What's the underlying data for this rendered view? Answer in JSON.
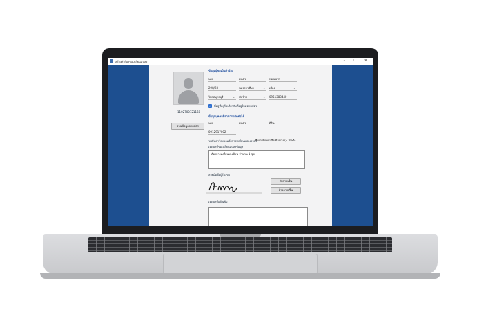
{
  "window": {
    "title": "สร้างคำร้องขอเปลี่ยนแปลง",
    "controls": "– ☐ ✕"
  },
  "photo": {
    "id_number": "1102700721168",
    "scan_button": "อ่านข้อมูลจากบัตร"
  },
  "applicant": {
    "section_title": "ข้อมูลผู้ขอเป็นคำร้อง",
    "title": "นาย",
    "first_name": "มนตร",
    "last_name": "ทองเพชร",
    "house_no": "298/23",
    "district": "นครราชสีมา",
    "subdistrict": "เมือง",
    "province": "ไทรสมุทรบุรี",
    "zone": "ทับข้าง",
    "phone": "0951383440",
    "same_address_label": "ที่อยู่ที่อยู่ร้อเดียวกับที่อยู่ใหม่ตามบัตร"
  },
  "contact": {
    "section_title": "ข้อมูลบุคคลที่สามารถติดต่อได้",
    "title": "นาย",
    "first_name": "มนตร",
    "last_name": "ศิริน",
    "phone": "0912917002"
  },
  "request": {
    "type_label": "ขอยื่นคำร้องขอแจ้งการเปลี่ยนแปลงรายนี้",
    "type_value": "ยืนยันชื่อหนังสือเดินทาง (E VISA)",
    "details_label": "เหตุผลที่ขอเปลี่ยนแปลงข้อมูล",
    "details_value": "ต้องการเปลี่ยนทะเบียน จำนวน 1 ชุด"
  },
  "signature": {
    "label": "ลายมือชื่อผู้ร้องขอ",
    "sign_button": "รับลายเซ็น",
    "clear_button": "ล้างลายเซ็น"
  },
  "notes": {
    "label": "เหตุผลที่แจ้งเพิ่ม"
  },
  "icons": {
    "dropdown": "chevron-down-icon",
    "check": "check-icon",
    "avatar": "avatar-placeholder-icon"
  },
  "colors": {
    "side_panel": "#1d4f90",
    "section_title": "#1f4e9e",
    "checkbox": "#2e6fd0"
  }
}
